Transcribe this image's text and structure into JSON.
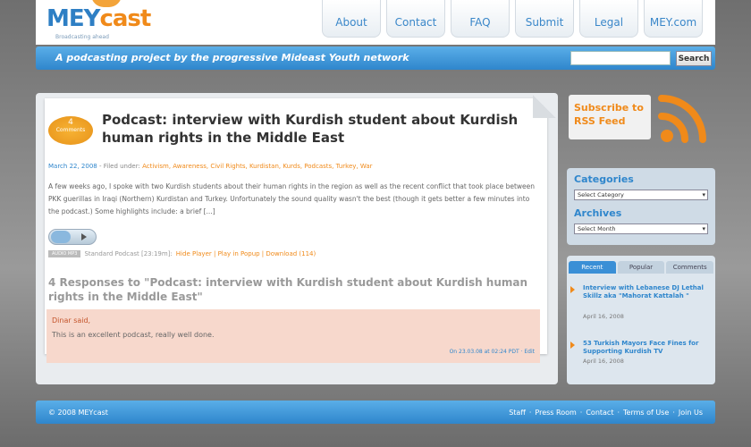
{
  "header": {
    "logo_mey": "MEY",
    "logo_cast": "cast",
    "logo_tag": "Broadcasting ahead",
    "nav": [
      "About",
      "Contact",
      "FAQ",
      "Submit",
      "Legal",
      "MEY.com"
    ]
  },
  "bar": {
    "tagline": "A podcasting project by the progressive Mideast Youth network",
    "search_value": "",
    "search_button": "Search"
  },
  "post": {
    "comment_count": "4",
    "comment_label": "Comments",
    "title": "Podcast: interview with Kurdish student about Kurdish human rights in the Middle East",
    "date": "March 22, 2008",
    "filed_under": " - Filed under: ",
    "tags": "Activism, Awareness, Civil Rights, Kurdistan, Kurds, Podcasts, Turkey, War",
    "excerpt": "A few weeks ago, I spoke with two Kurdish students about their human rights in the region as well as the recent conflict that took place between PKK guerillas in Iraqi (Northern) Kurdistan and Turkey. Unfortunately the sound quality wasn't the best (though it gets better a few minutes into the podcast.) Some highlights include: a brief [...]",
    "audio_badge": "AUDIO MP3",
    "audio_text": "Standard Podcast [23:19m]:",
    "audio_links": "Hide Player | Play in Popup | Download (114)"
  },
  "responses": {
    "title": "4 Responses to \"Podcast: interview with Kurdish student about Kurdish human rights in the Middle East\"",
    "comment": {
      "author": "Dinar said,",
      "text": "This is an excellent podcast, really well done.",
      "meta": "On 23.03.08 at 02:24 PDT · Edit"
    }
  },
  "sidebar": {
    "rss_text": "Subscribe to RSS Feed",
    "categories_title": "Categories",
    "categories_select": "Select Category",
    "archives_title": "Archives",
    "archives_select": "Select Month",
    "tabs": [
      "Recent",
      "Popular",
      "Comments"
    ],
    "items": [
      {
        "title": "Interview with Lebanese DJ Lethal Skillz aka \"Mahorat Kattalah \"",
        "date": "April 16, 2008"
      },
      {
        "title": "53 Turkish Mayors Face Fines for Supporting Kurdish TV",
        "date": "April 16, 2008"
      }
    ]
  },
  "footer": {
    "copyright": "© 2008 MEYcast",
    "links": [
      "Staff",
      "Press Room",
      "Contact",
      "Terms of Use",
      "Join Us"
    ]
  },
  "colors": {
    "accent_blue": "#2f86cc",
    "accent_orange": "#f08a1a"
  }
}
